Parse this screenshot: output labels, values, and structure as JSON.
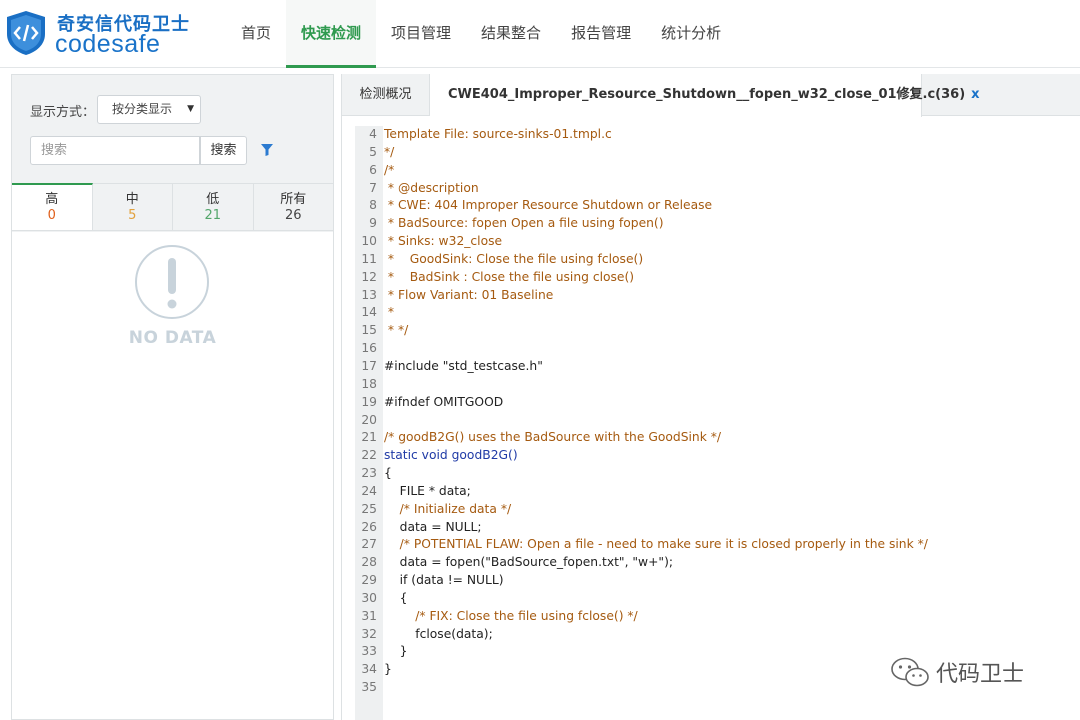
{
  "brand": {
    "name_cn": "奇安信代码卫士",
    "name_en": "codesafe"
  },
  "nav": [
    {
      "label": "首页"
    },
    {
      "label": "快速检测"
    },
    {
      "label": "项目管理"
    },
    {
      "label": "结果整合"
    },
    {
      "label": "报告管理"
    },
    {
      "label": "统计分析"
    }
  ],
  "left": {
    "display_label": "显示方式：",
    "display_select": "按分类显示",
    "search_placeholder": "搜索",
    "search_button": "搜索",
    "tabs": [
      {
        "label": "高",
        "count": "0"
      },
      {
        "label": "中",
        "count": "5"
      },
      {
        "label": "低",
        "count": "21"
      },
      {
        "label": "所有",
        "count": "26"
      }
    ],
    "empty_text": "NO DATA"
  },
  "right": {
    "tabs": [
      {
        "label": "检测概况"
      },
      {
        "label": "CWE404_Improper_Resource_Shutdown__fopen_w32_close_01修复.c(36)",
        "close": "x"
      }
    ],
    "code": [
      {
        "n": "4",
        "t": "Template File: source-sinks-01.tmpl.c"
      },
      {
        "n": "5",
        "t": "*/"
      },
      {
        "n": "6",
        "t": "/*"
      },
      {
        "n": "7",
        "t": " * @description"
      },
      {
        "n": "8",
        "t": " * CWE: 404 Improper Resource Shutdown or Release"
      },
      {
        "n": "9",
        "t": " * BadSource: fopen Open a file using fopen()"
      },
      {
        "n": "10",
        "t": " * Sinks: w32_close"
      },
      {
        "n": "11",
        "t": " *    GoodSink: Close the file using fclose()"
      },
      {
        "n": "12",
        "t": " *    BadSink : Close the file using close()"
      },
      {
        "n": "13",
        "t": " * Flow Variant: 01 Baseline"
      },
      {
        "n": "14",
        "t": " *"
      },
      {
        "n": "15",
        "t": " * */"
      },
      {
        "n": "16",
        "t": ""
      },
      {
        "n": "17",
        "t": "#include \"std_testcase.h\""
      },
      {
        "n": "18",
        "t": ""
      },
      {
        "n": "19",
        "t": "#ifndef OMITGOOD"
      },
      {
        "n": "20",
        "t": ""
      },
      {
        "n": "21",
        "t": "/* goodB2G() uses the BadSource with the GoodSink */"
      },
      {
        "n": "22",
        "t": "static void goodB2G()"
      },
      {
        "n": "23",
        "t": "{"
      },
      {
        "n": "24",
        "t": "    FILE * data;"
      },
      {
        "n": "25",
        "t": "    /* Initialize data */"
      },
      {
        "n": "26",
        "t": "    data = NULL;"
      },
      {
        "n": "27",
        "t": "    /* POTENTIAL FLAW: Open a file - need to make sure it is closed properly in the sink */"
      },
      {
        "n": "28",
        "t": "    data = fopen(\"BadSource_fopen.txt\", \"w+\");"
      },
      {
        "n": "29",
        "t": "    if (data != NULL)"
      },
      {
        "n": "30",
        "t": "    {"
      },
      {
        "n": "31",
        "t": "        /* FIX: Close the file using fclose() */"
      },
      {
        "n": "32",
        "t": "        fclose(data);"
      },
      {
        "n": "33",
        "t": "    }"
      },
      {
        "n": "34",
        "t": "}"
      },
      {
        "n": "35",
        "t": ""
      }
    ]
  },
  "watermark": {
    "text": "代码卫士"
  },
  "colors": {
    "accent": "#2f9a4f",
    "brand": "#1a73c9",
    "high": "#e0601c",
    "medium": "#e2a13c",
    "low": "#53a66a",
    "comment": "#a55a10",
    "keyword": "#1f3aa6"
  }
}
